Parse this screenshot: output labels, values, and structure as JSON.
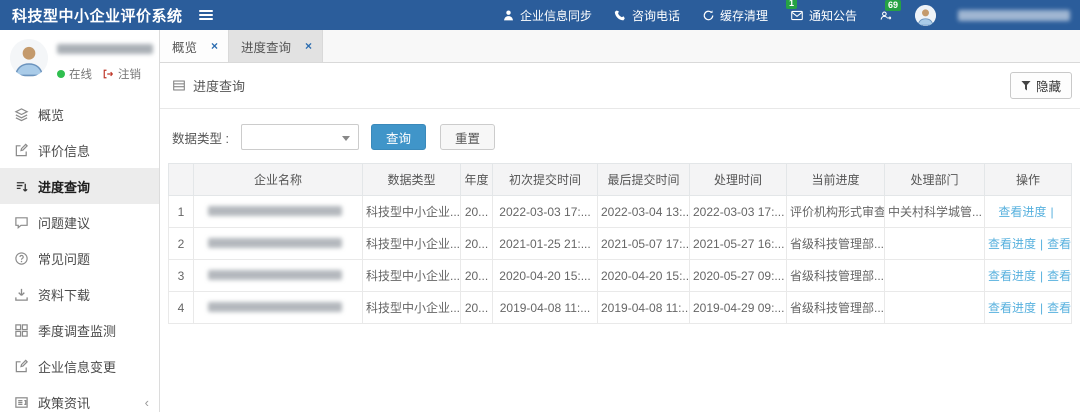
{
  "app": {
    "title": "科技型中小企业评价系统"
  },
  "header": {
    "nav": [
      {
        "label": "企业信息同步",
        "icon": "user-icon"
      },
      {
        "label": "咨询电话",
        "icon": "phone-icon"
      },
      {
        "label": "缓存清理",
        "icon": "recycle-icon"
      },
      {
        "label": "通知公告",
        "icon": "envelope-icon",
        "badge": "1"
      },
      {
        "label": "",
        "icon": "message-user-icon",
        "badge": "69"
      }
    ]
  },
  "sidebar": {
    "online_label": "在线",
    "logout_label": "注销",
    "items": [
      {
        "label": "概览",
        "icon": "layers-icon"
      },
      {
        "label": "评价信息",
        "icon": "edit-icon"
      },
      {
        "label": "进度查询",
        "icon": "sort-icon",
        "active": true
      },
      {
        "label": "问题建议",
        "icon": "comment-icon"
      },
      {
        "label": "常见问题",
        "icon": "question-icon"
      },
      {
        "label": "资料下载",
        "icon": "download-icon"
      },
      {
        "label": "季度调查监测",
        "icon": "grid-icon"
      },
      {
        "label": "企业信息变更",
        "icon": "edit-icon"
      },
      {
        "label": "政策资讯",
        "icon": "news-icon",
        "has_submenu": true
      }
    ]
  },
  "tabs": [
    {
      "label": "概览"
    },
    {
      "label": "进度查询",
      "active": true
    }
  ],
  "panel": {
    "title": "进度查询",
    "hide_button": "隐藏"
  },
  "filter": {
    "label": "数据类型 :",
    "select_value": "",
    "search_button": "查询",
    "reset_button": "重置"
  },
  "table": {
    "headers": [
      "",
      "企业名称",
      "数据类型",
      "年度",
      "初次提交时间",
      "最后提交时间",
      "处理时间",
      "当前进度",
      "处理部门",
      "操作"
    ],
    "rows": [
      {
        "num": "1",
        "data_type": "科技型中小企业...",
        "year": "20...",
        "first_submit": "2022-03-03 17:...",
        "last_submit": "2022-03-04 13:...",
        "process_time": "2022-03-03 17:...",
        "progress": "评价机构形式审查",
        "department": "中关村科学城管...",
        "actions": [
          "查看进度"
        ],
        "trailing_separator": true
      },
      {
        "num": "2",
        "data_type": "科技型中小企业...",
        "year": "20...",
        "first_submit": "2021-01-25 21:...",
        "last_submit": "2021-05-07 17:...",
        "process_time": "2021-05-27 16:...",
        "progress": "省级科技管理部...",
        "department": "",
        "actions": [
          "查看进度",
          "查看..."
        ],
        "trailing_separator": false
      },
      {
        "num": "3",
        "data_type": "科技型中小企业...",
        "year": "20...",
        "first_submit": "2020-04-20 15:...",
        "last_submit": "2020-04-20 15:...",
        "process_time": "2020-05-27 09:...",
        "progress": "省级科技管理部...",
        "department": "",
        "actions": [
          "查看进度",
          "查看..."
        ],
        "trailing_separator": false
      },
      {
        "num": "4",
        "data_type": "科技型中小企业...",
        "year": "20...",
        "first_submit": "2019-04-08 11:...",
        "last_submit": "2019-04-08 11:...",
        "process_time": "2019-04-29 09:...",
        "progress": "省级科技管理部...",
        "department": "",
        "actions": [
          "查看进度",
          "查看..."
        ],
        "trailing_separator": false
      }
    ]
  },
  "colors": {
    "header_blue": "#2b5d9b",
    "badge_green": "#25a244",
    "link_blue": "#58b1de",
    "search_button_blue": "#4095c9"
  }
}
